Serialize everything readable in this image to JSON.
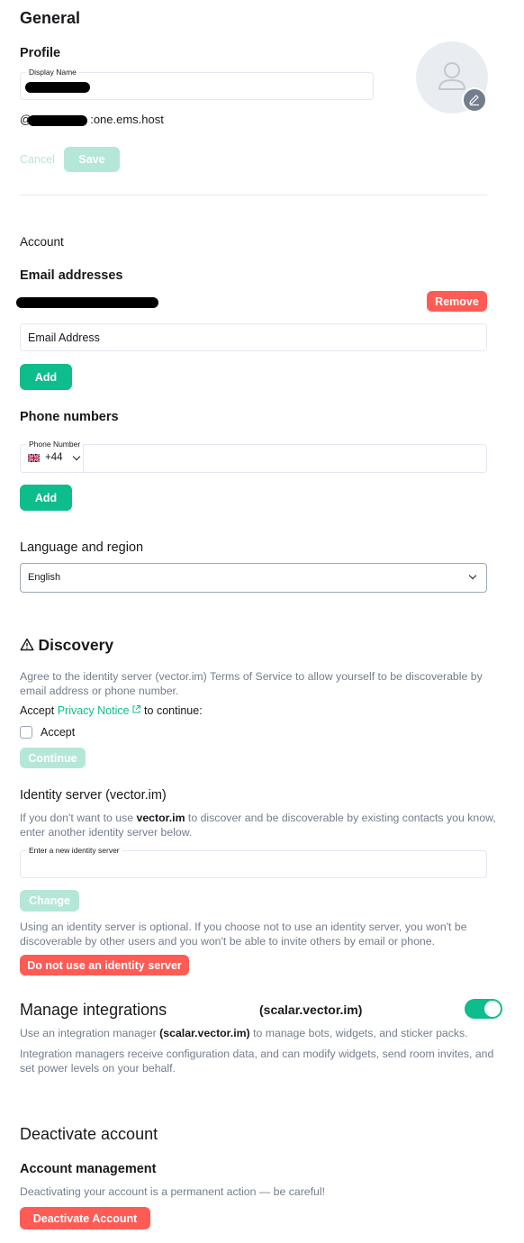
{
  "general": {
    "title": "General",
    "profile_heading": "Profile",
    "display_name_label": "Display Name",
    "user_id_prefix": "@",
    "user_id_suffix": ":one.ems.host",
    "cancel_label": "Cancel",
    "save_label": "Save"
  },
  "account": {
    "heading": "Account",
    "email_heading": "Email addresses",
    "remove_label": "Remove",
    "email_placeholder": "Email Address",
    "email_add_label": "Add",
    "phone_heading": "Phone numbers",
    "phone_label": "Phone Number",
    "phone_country_code": "+44",
    "phone_add_label": "Add",
    "language_heading": "Language and region",
    "language_value": "English"
  },
  "discovery": {
    "title": "Discovery",
    "description": "Agree to the identity server (vector.im) Terms of Service to allow yourself to be discoverable by email address or phone number.",
    "accept_prefix": "Accept ",
    "privacy_link": "Privacy Notice",
    "accept_suffix": " to continue:",
    "accept_checkbox_label": "Accept",
    "continue_label": "Continue",
    "identity_heading": "Identity server (vector.im)",
    "identity_desc_1": "If you don't want to use ",
    "identity_desc_bold": "vector.im",
    "identity_desc_2": " to discover and be discoverable by existing contacts you know, enter another identity server below.",
    "identity_input_label": "Enter a new identity server",
    "change_label": "Change",
    "optional_note": "Using an identity server is optional. If you choose not to use an identity server, you won't be discoverable by other users and you won't be able to invite others by email or phone.",
    "do_not_use_label": "Do not use an identity server"
  },
  "integrations": {
    "title": "Manage integrations",
    "server": "(scalar.vector.im)",
    "desc_1": "Use an integration manager ",
    "desc_bold": "(scalar.vector.im)",
    "desc_2": " to manage bots, widgets, and sticker packs.",
    "desc_more": "Integration managers receive configuration data, and can modify widgets, send room invites, and set power levels on your behalf.",
    "enabled": true
  },
  "deactivate": {
    "title": "Deactivate account",
    "subheading": "Account management",
    "warning": "Deactivating your account is a permanent action — be careful!",
    "button_label": "Deactivate Account"
  },
  "colors": {
    "accent": "#0dbd8b",
    "danger": "#ff5b55",
    "muted_text": "#737d8c"
  },
  "icons": {
    "avatar": "user-placeholder-icon",
    "avatar_edit": "pencil-icon",
    "flag": "uk-flag-icon",
    "warning": "warning-triangle-icon",
    "external_link": "external-link-icon"
  }
}
